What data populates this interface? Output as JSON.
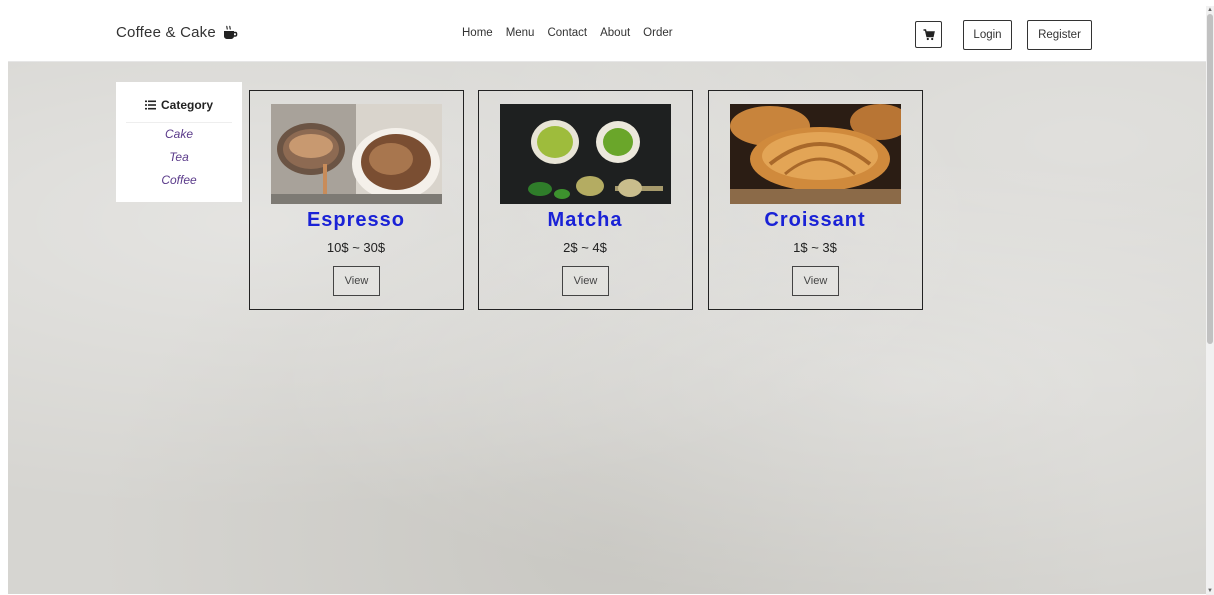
{
  "navbar": {
    "brand": "Coffee & Cake",
    "brand_icon": "coffee-cup-icon",
    "links": [
      "Home",
      "Menu",
      "Contact",
      "About",
      "Order"
    ],
    "cart_icon": "cart-icon",
    "login_label": "Login",
    "register_label": "Register"
  },
  "sidebar": {
    "title": "Category",
    "title_icon": "list-icon",
    "items": [
      "Cake",
      "Tea",
      "Coffee"
    ]
  },
  "products": [
    {
      "name": "Espresso",
      "price": "10$ ~ 30$",
      "view_label": "View"
    },
    {
      "name": "Matcha",
      "price": "2$ ~ 4$",
      "view_label": "View"
    },
    {
      "name": "Croissant",
      "price": "1$ ~ 3$",
      "view_label": "View"
    }
  ],
  "colors": {
    "product_name": "#1a22d6",
    "category_link": "#5a3a8a",
    "background": "#d6d5d1"
  }
}
